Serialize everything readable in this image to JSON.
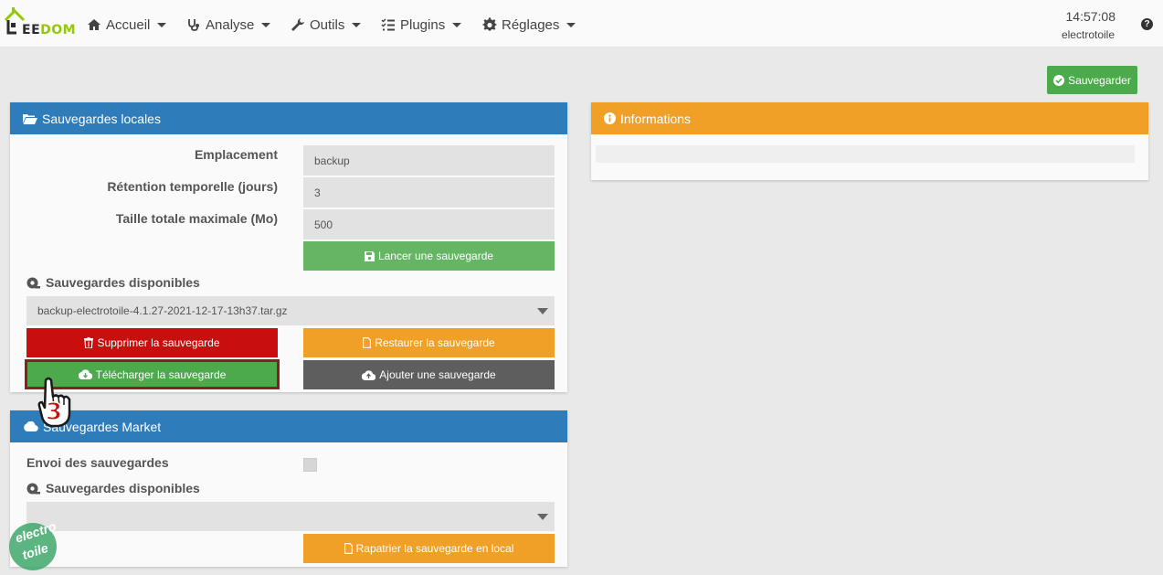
{
  "navbar": {
    "logo_text_left": "EE",
    "logo_text_right": "DOM",
    "menu": [
      {
        "label": "Accueil",
        "icon": "home-icon"
      },
      {
        "label": "Analyse",
        "icon": "stethoscope-icon"
      },
      {
        "label": "Outils",
        "icon": "wrench-icon"
      },
      {
        "label": "Plugins",
        "icon": "tasks-icon"
      },
      {
        "label": "Réglages",
        "icon": "gear-icon"
      }
    ],
    "time": "14:57:08",
    "hostname": "electrotoile",
    "help_glyph": "?"
  },
  "toolbar": {
    "save_label": "Sauvegarder"
  },
  "local_backups": {
    "title": "Sauvegardes locales",
    "location_label": "Emplacement",
    "location_value": "backup",
    "retention_label": "Rétention temporelle (jours)",
    "retention_value": "3",
    "max_size_label": "Taille totale maximale (Mo)",
    "max_size_value": "500",
    "launch_button": "Lancer une sauvegarde",
    "available_label": "Sauvegardes disponibles",
    "selected_backup": "backup-electrotoile-4.1.27-2021-12-17-13h37.tar.gz",
    "delete_button": "Supprimer la sauvegarde",
    "restore_button": "Restaurer la sauvegarde",
    "download_button": "Télécharger la sauvegarde",
    "add_button": "Ajouter une sauvegarde"
  },
  "market_backups": {
    "title": "Sauvegardes Market",
    "send_label": "Envoi des sauvegardes",
    "available_label": "Sauvegardes disponibles",
    "selected_backup": "",
    "repatriate_button": "Rapatrier la sauvegarde en local"
  },
  "informations": {
    "title": "Informations"
  },
  "annotation": {
    "step_number": "3",
    "watermark_line1": "electro",
    "watermark_line2": "toile"
  },
  "colors": {
    "blue": "#2f7cbb",
    "orange": "#f09f27",
    "green": "#4ca94c",
    "red": "#c90e0e",
    "dark": "#5e5e5e",
    "brand_green": "#94ca02"
  }
}
